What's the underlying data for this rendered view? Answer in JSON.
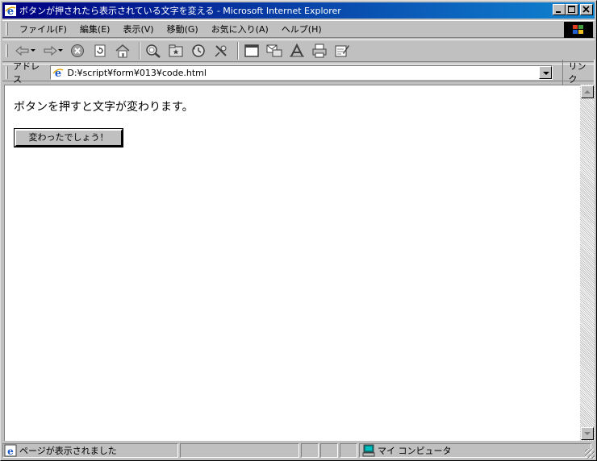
{
  "window": {
    "title": "ボタンが押されたら表示されている文字を変える - Microsoft Internet Explorer",
    "minimize": "_",
    "maximize": "□",
    "close": "×"
  },
  "menu": {
    "items": [
      "ファイル(F)",
      "編集(E)",
      "表示(V)",
      "移動(G)",
      "お気に入り(A)",
      "ヘルプ(H)"
    ]
  },
  "toolbar": {
    "icons": [
      "back-icon",
      "forward-icon",
      "stop-icon",
      "refresh-icon",
      "home-icon",
      "search-icon",
      "favorites-icon",
      "history-icon",
      "channels-icon",
      "fullscreen-icon",
      "mail-icon",
      "font-icon",
      "print-icon",
      "edit-icon"
    ]
  },
  "address": {
    "label": "アドレス",
    "value": "D:¥script¥form¥013¥code.html",
    "links": "リンク"
  },
  "page": {
    "text": "ボタンを押すと文字が変わります。",
    "button": "変わったでしょう！"
  },
  "status": {
    "message": "ページが表示されました",
    "zone": "マイ コンピュータ"
  },
  "colors": {
    "title_start": "#000080",
    "title_end": "#1084d0",
    "chrome": "#c0c0c0"
  }
}
